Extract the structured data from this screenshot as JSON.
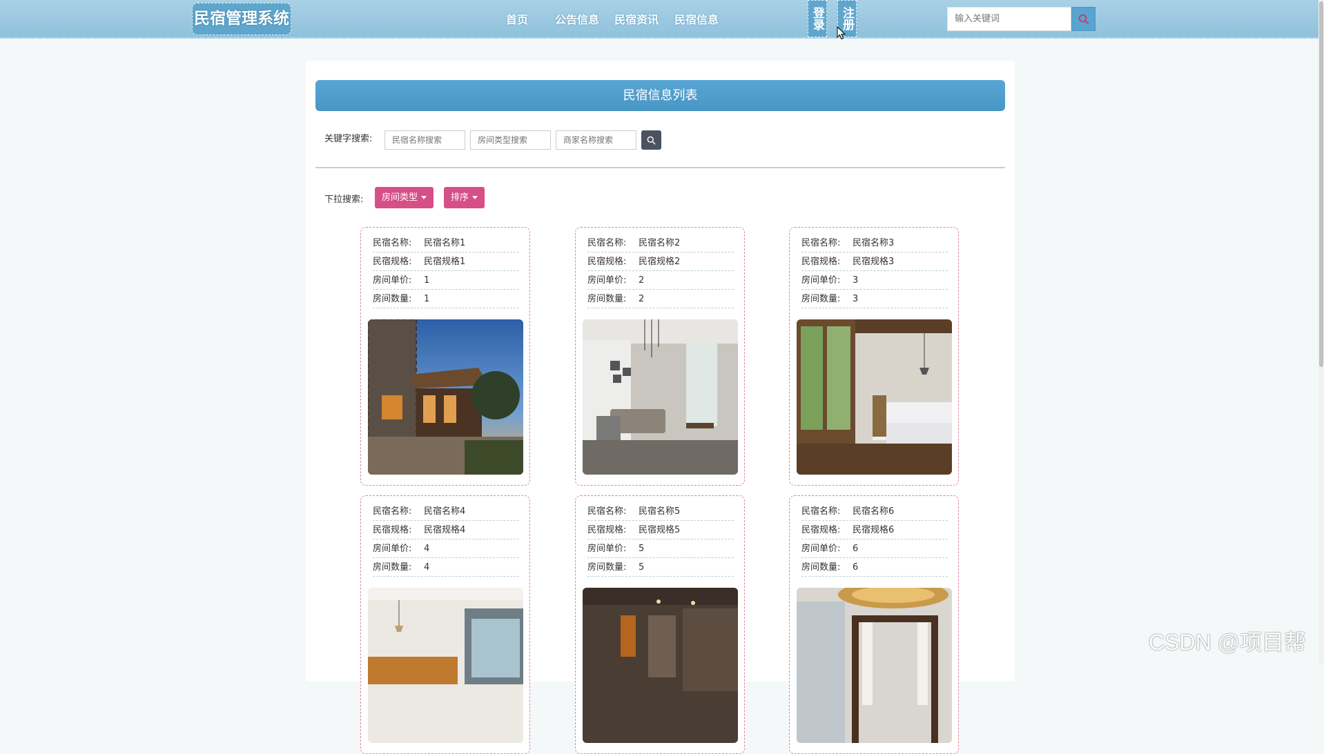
{
  "header": {
    "logo": "民宿管理系统",
    "nav": [
      "首页",
      "公告信息",
      "民宿资讯",
      "民宿信息"
    ],
    "login_label": "登录",
    "register_label": "注册",
    "search_placeholder": "输入关键词"
  },
  "main": {
    "title": "民宿信息列表",
    "keyword_label": "关键字搜索:",
    "keyword_inputs": [
      "民宿名称搜索",
      "房间类型搜索",
      "商家名称搜索"
    ],
    "dropdown_label": "下拉搜索:",
    "dropdowns": [
      "房间类型",
      "排序"
    ],
    "field_labels": {
      "name": "民宿名称:",
      "spec": "民宿规格:",
      "price": "房间单价:",
      "quantity": "房间数量:"
    },
    "cards": [
      {
        "name": "民宿名称1",
        "spec": "民宿规格1",
        "price": "1",
        "quantity": "1"
      },
      {
        "name": "民宿名称2",
        "spec": "民宿规格2",
        "price": "2",
        "quantity": "2"
      },
      {
        "name": "民宿名称3",
        "spec": "民宿规格3",
        "price": "3",
        "quantity": "3"
      },
      {
        "name": "民宿名称4",
        "spec": "民宿规格4",
        "price": "4",
        "quantity": "4"
      },
      {
        "name": "民宿名称5",
        "spec": "民宿规格5",
        "price": "5",
        "quantity": "5"
      },
      {
        "name": "民宿名称6",
        "spec": "民宿规格6",
        "price": "6",
        "quantity": "6"
      }
    ]
  },
  "watermark": "CSDN @项目帮",
  "colors": {
    "header": "#9ccae2",
    "title_bar": "#4f9dcb",
    "dropdown": "#d64f86",
    "card_border": "#e0839d"
  },
  "icons": [
    "search-icon",
    "caret-down-icon",
    "cursor-icon"
  ]
}
